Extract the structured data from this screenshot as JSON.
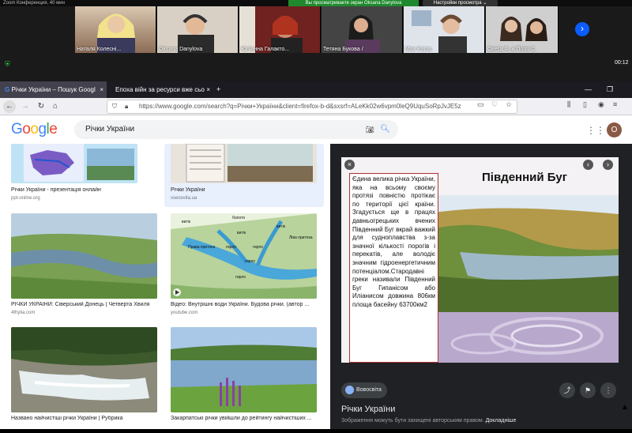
{
  "zoom": {
    "title": "Zoom Конференция, 40 мин",
    "share_banner": "Вы просматриваете экран Oksana Danylova",
    "view_options": "Настройки просмотра",
    "participants": [
      {
        "name": "Наталя Колесні..."
      },
      {
        "name": "Oksana Danylova"
      },
      {
        "name": "Юліанна Галакто..."
      },
      {
        "name": "Тетяна Букова /"
      },
      {
        "name": "Max Karas"
      },
      {
        "name": "Света Ф. и Поля С."
      }
    ],
    "timer": "00:12"
  },
  "browser": {
    "tabs": [
      {
        "label": "Річки України – Пошук Googl"
      },
      {
        "label": "Епоха війн за ресурси вже сьо"
      }
    ],
    "url": "https://www.google.com/search?q=Річки+України&client=firefox-b-d&sxsrf=ALeKk02w6vpm0leQ9UquSoRpJvJE5z"
  },
  "google": {
    "query": "Річки України",
    "avatar_letter": "O"
  },
  "results": [
    {
      "title": "Річки України - презентація онлайн",
      "source": "ppt-online.org"
    },
    {
      "title": "Річки України",
      "source": "vseosvita.ua"
    },
    {
      "title": "РІЧКИ УКРАЇНИ: Сіверський Донець | Четверта Хвиля",
      "source": "4thylia.com"
    },
    {
      "title": "Відео: Внутрішні води України. Будова річки. (автор ...",
      "source": "youtube.com"
    },
    {
      "title": "Названо найчистіші річки України | Рубрика",
      "source": ""
    },
    {
      "title": "Закарпатські річки увійшли до рейтингу найчистіших ...",
      "source": ""
    }
  ],
  "diagram_labels": [
    "болото",
    "витік",
    "витік",
    "витік",
    "Ліва притока",
    "Права притока",
    "гирло",
    "гирло",
    "гирло",
    "гирло"
  ],
  "panel": {
    "slide_title": "Південний Буг",
    "slide_text": "Єдина велика річка України, яка на всьому своєму протязі повністю протікає по території цієї країни. Згадується ще в працях давньогрецьких вчених Південний Буг вкрай важкий для судноплавства з-за значної кількості порогів і перекатів, але володіє значним гідроенергетичним потенціалом.Стародавні греки називали Південний Буг Гипанісом або Иліанисом довжина 806км площа басейну 63700км2",
    "source": "Вовосвіта",
    "title": "Річки України",
    "note": "Зображення можуть бути захищені авторським правом.",
    "note_link": "Докладніше"
  }
}
